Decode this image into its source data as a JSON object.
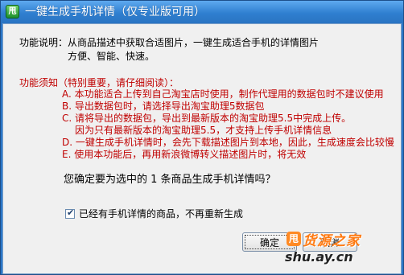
{
  "window": {
    "title": "一键生成手机详情（仅专业版可用）",
    "icon_glyph": "甩"
  },
  "intro": {
    "label": "功能说明：",
    "line1": "从商品描述中获取合适图片，一键生成适合手机的详情图片",
    "line2": "方便、智能、快速。"
  },
  "notice": {
    "header": "功能须知（特别重要，请仔细阅读）：",
    "items": [
      "A. 本功能适合上传到自己淘宝店时使用，制作代理用的数据包时不建议使用",
      "B. 导出数据包时，请选择导出淘宝助理5数据包",
      "C. 请将导出的数据包，导出到最新版本的淘宝助理5.5中完成上传。",
      "因为只有最新版本的淘宝助理5.5，才支持上传手机详情信息",
      "D. 一键生成手机详情时，会先下载描述图片到本地，因此，生成速度会比较慢",
      "E. 使用本功能后，再用新浪微博转义描述图片时，将无效"
    ]
  },
  "question": "您确定要为选中的 1 条商品生成手机详情吗？",
  "checkbox": {
    "label": "已经有手机详情的商品，不再重新生成",
    "checked": true
  },
  "buttons": {
    "ok": "确定",
    "cancel": "取消"
  },
  "watermark": {
    "logo": "甩",
    "top": "货源之家",
    "bottom": "shu.ay.cn"
  }
}
